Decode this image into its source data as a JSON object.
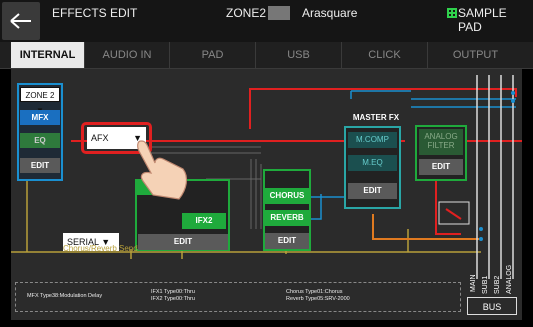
{
  "header": {
    "back_label": "←",
    "title": "EFFECTS EDIT",
    "zone": "ZONE2",
    "kit_name": "Arasquare",
    "sample_pad": "SAMPLE PAD"
  },
  "tabs": [
    {
      "label": "INTERNAL"
    },
    {
      "label": "AUDIO IN"
    },
    {
      "label": "PAD"
    },
    {
      "label": "USB"
    },
    {
      "label": "CLICK"
    },
    {
      "label": "OUTPUT"
    }
  ],
  "zone_select": "ZONE 2",
  "mfx": {
    "label": "MFX",
    "eq": "EQ",
    "edit": "EDIT"
  },
  "afx": "AFX",
  "ifx": {
    "ifx2": "IFX2",
    "edit": "EDIT",
    "mode": "SERIAL"
  },
  "fx": {
    "chorus": "CHORUS",
    "reverb": "REVERB",
    "edit": "EDIT"
  },
  "master": {
    "title": "MASTER FX",
    "mcomp": "M.COMP",
    "meq": "M.EQ",
    "edit": "EDIT"
  },
  "analog": {
    "line1": "ANALOG",
    "line2": "FILTER",
    "edit": "EDIT"
  },
  "send_label": "Chorus/Reverb Send",
  "outputs": {
    "main": "MAIN",
    "sub1": "SUB1",
    "sub2": "SUB2",
    "analog": "ANALOG",
    "bus": "BUS"
  },
  "status": {
    "mfx": "MFX Type38:Modulation Delay",
    "ifx1": "IFX1 Type00:Thru",
    "ifx2": "IFX2 Type00:Thru",
    "chorus": "Chorus Type01:Chorus",
    "reverb": "Reverb Type05:SRV-2000"
  },
  "colors": {
    "green": "#1faa3c",
    "blue": "#1a6fc0",
    "red": "#e02020",
    "teal": "#2aa6a6",
    "orange": "#e07a20"
  }
}
